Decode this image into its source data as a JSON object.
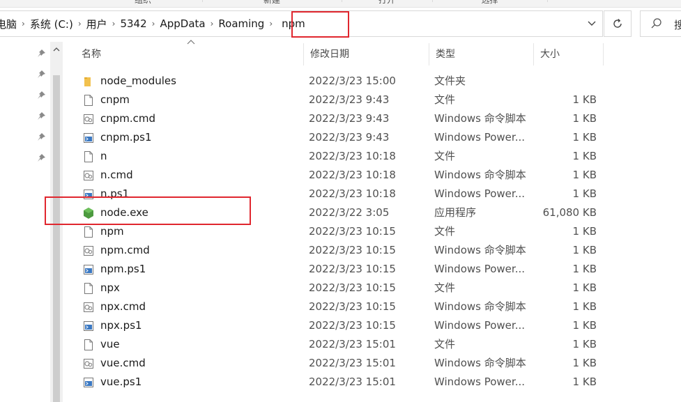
{
  "ribbon": {
    "groups": [
      "组织",
      "新建",
      "打开",
      "选择"
    ]
  },
  "address": {
    "crumbs": [
      "电脑",
      "系统 (C:)",
      "用户",
      "5342",
      "AppData",
      "Roaming",
      "npm"
    ]
  },
  "search": {
    "placeholder": "搜"
  },
  "columns": {
    "name": "名称",
    "date": "修改日期",
    "type": "类型",
    "size": "大小"
  },
  "files": [
    {
      "icon": "folder-icon",
      "name": "node_modules",
      "date": "2022/3/23 15:00",
      "type": "文件夹",
      "size": ""
    },
    {
      "icon": "file-icon",
      "name": "cnpm",
      "date": "2022/3/23 9:43",
      "type": "文件",
      "size": "1 KB"
    },
    {
      "icon": "cmd-file-icon",
      "name": "cnpm.cmd",
      "date": "2022/3/23 9:43",
      "type": "Windows 命令脚本",
      "size": "1 KB"
    },
    {
      "icon": "ps1-file-icon",
      "name": "cnpm.ps1",
      "date": "2022/3/23 9:43",
      "type": "Windows Power...",
      "size": "1 KB"
    },
    {
      "icon": "file-icon",
      "name": "n",
      "date": "2022/3/23 10:18",
      "type": "文件",
      "size": "1 KB"
    },
    {
      "icon": "cmd-file-icon",
      "name": "n.cmd",
      "date": "2022/3/23 10:18",
      "type": "Windows 命令脚本",
      "size": "1 KB"
    },
    {
      "icon": "ps1-file-icon",
      "name": "n.ps1",
      "date": "2022/3/23 10:18",
      "type": "Windows Power...",
      "size": "1 KB"
    },
    {
      "icon": "node-exe-icon",
      "name": "node.exe",
      "date": "2022/3/22 3:05",
      "type": "应用程序",
      "size": "61,080 KB"
    },
    {
      "icon": "file-icon",
      "name": "npm",
      "date": "2022/3/23 10:15",
      "type": "文件",
      "size": "1 KB"
    },
    {
      "icon": "cmd-file-icon",
      "name": "npm.cmd",
      "date": "2022/3/23 10:15",
      "type": "Windows 命令脚本",
      "size": "1 KB"
    },
    {
      "icon": "ps1-file-icon",
      "name": "npm.ps1",
      "date": "2022/3/23 10:15",
      "type": "Windows Power...",
      "size": "1 KB"
    },
    {
      "icon": "file-icon",
      "name": "npx",
      "date": "2022/3/23 10:15",
      "type": "文件",
      "size": "1 KB"
    },
    {
      "icon": "cmd-file-icon",
      "name": "npx.cmd",
      "date": "2022/3/23 10:15",
      "type": "Windows 命令脚本",
      "size": "1 KB"
    },
    {
      "icon": "ps1-file-icon",
      "name": "npx.ps1",
      "date": "2022/3/23 10:15",
      "type": "Windows Power...",
      "size": "1 KB"
    },
    {
      "icon": "file-icon",
      "name": "vue",
      "date": "2022/3/23 15:01",
      "type": "文件",
      "size": "1 KB"
    },
    {
      "icon": "cmd-file-icon",
      "name": "vue.cmd",
      "date": "2022/3/23 15:01",
      "type": "Windows 命令脚本",
      "size": "1 KB"
    },
    {
      "icon": "ps1-file-icon",
      "name": "vue.ps1",
      "date": "2022/3/23 15:01",
      "type": "Windows Power...",
      "size": "1 KB"
    }
  ],
  "colors": {
    "highlight": "#e0262e",
    "folder": "#f2c14e",
    "node_exe": "#4c9a3f"
  }
}
